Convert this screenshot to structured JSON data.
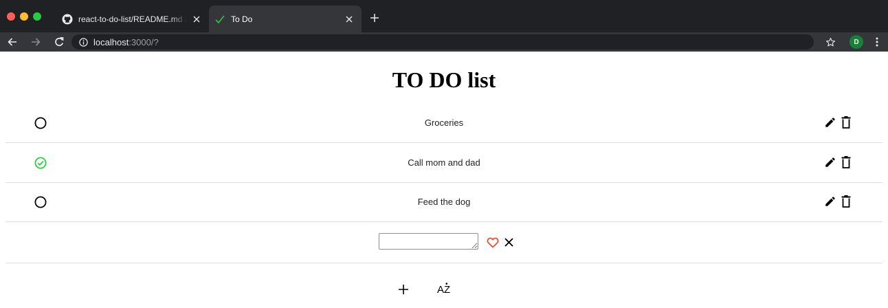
{
  "browser": {
    "tabs": [
      {
        "title": "react-to-do-list/README.md at",
        "favicon": "github-icon",
        "active": false
      },
      {
        "title": "To Do",
        "favicon": "checkmark-icon",
        "active": true
      }
    ],
    "url_host": "localhost",
    "url_rest": ":3000/?",
    "profile_initial": "D",
    "colors": {
      "frame": "#202124",
      "toolbar": "#35363a",
      "profile": "#188038"
    }
  },
  "page": {
    "title": "TO DO list"
  },
  "todos": [
    {
      "text": "Groceries",
      "completed": false
    },
    {
      "text": "Call mom and dad",
      "completed": true
    },
    {
      "text": "Feed the dog",
      "completed": false
    }
  ],
  "new_todo": {
    "value": "",
    "save_icon": "heart-icon",
    "cancel_icon": "close-icon"
  },
  "actions": {
    "add_icon": "plus-icon",
    "sort_label_a": "A",
    "sort_label_z": "Z",
    "sort_dot": "•"
  },
  "colors": {
    "completed": "#2ecc40",
    "save_heart": "#e8472b",
    "divider": "#dddddd"
  }
}
